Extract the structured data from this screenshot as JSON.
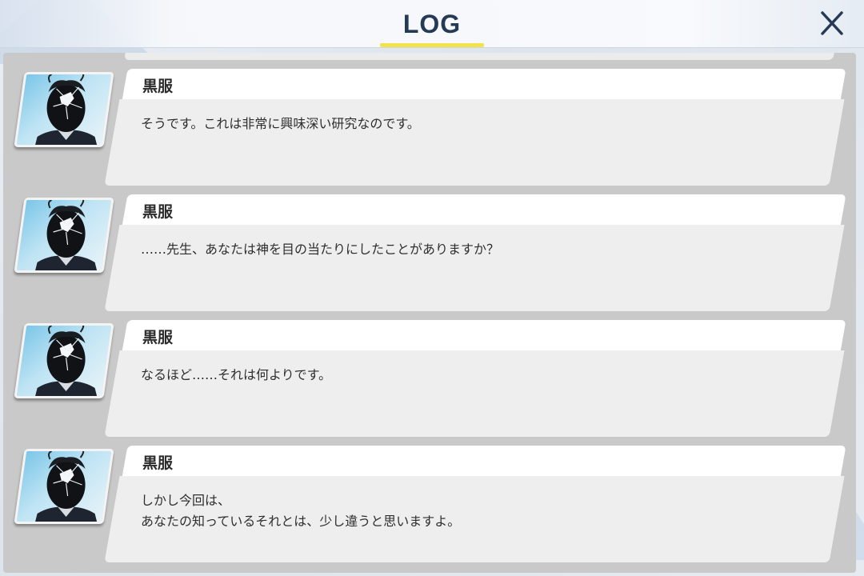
{
  "header": {
    "title": "LOG",
    "accent_color": "#f2e34a",
    "close_icon": "close-icon"
  },
  "log": {
    "entries": [
      {
        "speaker": "黒服",
        "text": "そうです。これは非常に興味深い研究なのです。",
        "portrait_icon": "kurofuku-portrait"
      },
      {
        "speaker": "黒服",
        "text": "……先生、あなたは神を目の当たりにしたことがありますか？",
        "portrait_icon": "kurofuku-portrait"
      },
      {
        "speaker": "黒服",
        "text": "なるほど……それは何よりです。",
        "portrait_icon": "kurofuku-portrait"
      },
      {
        "speaker": "黒服",
        "text": "しかし今回は、\nあなたの知っているそれとは、少し違うと思いますよ。",
        "portrait_icon": "kurofuku-portrait"
      }
    ]
  }
}
